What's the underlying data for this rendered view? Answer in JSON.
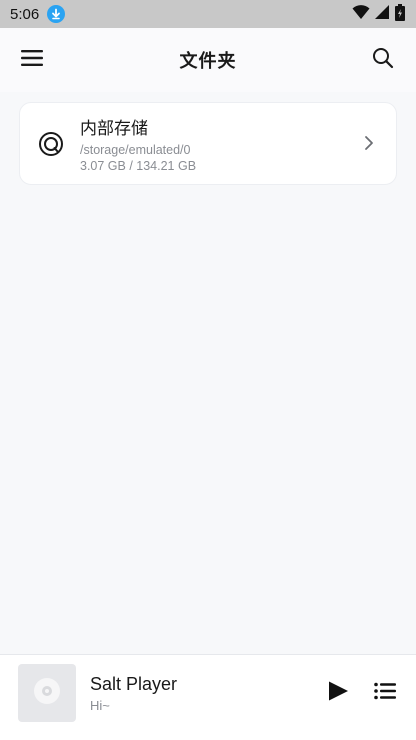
{
  "status_bar": {
    "time": "5:06",
    "download_icon": "download-arrow-icon",
    "wifi_icon": "wifi-icon",
    "signal_icon": "cell-signal-icon",
    "battery_icon": "battery-icon"
  },
  "app_bar": {
    "title": "文件夹",
    "menu_icon": "hamburger-menu-icon",
    "search_icon": "search-icon"
  },
  "storage": {
    "name": "内部存储",
    "path": "/storage/emulated/0",
    "usage": "3.07 GB / 134.21 GB",
    "icon": "storage-disk-icon",
    "chevron_icon": "chevron-right-icon"
  },
  "mini_player": {
    "title": "Salt Player",
    "subtitle": "Hi~",
    "cover_icon": "disc-icon",
    "play_icon": "play-icon",
    "queue_icon": "playlist-icon"
  }
}
